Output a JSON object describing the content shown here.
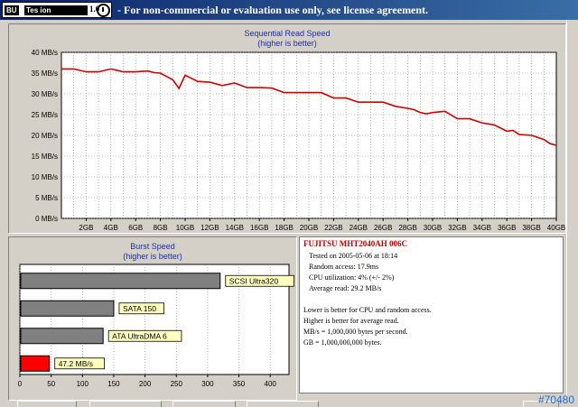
{
  "window": {
    "title_badge": "BU",
    "title_masked": "Tes      ion",
    "title_version": "1.0",
    "title_text": "- For non-commercial or evaluation use only, see license agreement."
  },
  "read_chart": {
    "title_line1": "Sequential Read Speed",
    "title_line2": "(higher is better)"
  },
  "burst_chart": {
    "title_line1": "Burst Speed",
    "title_line2": "(higher is better)"
  },
  "chart_data": [
    {
      "type": "line",
      "title": "Sequential Read Speed (higher is better)",
      "xlabel": "",
      "ylabel": "",
      "y_ticks": [
        "0 MB/s",
        "5 MB/s",
        "10 MB/s",
        "15 MB/s",
        "20 MB/s",
        "25 MB/s",
        "30 MB/s",
        "35 MB/s",
        "40 MB/s"
      ],
      "x_ticks": [
        "2GB",
        "4GB",
        "6GB",
        "8GB",
        "10GB",
        "12GB",
        "14GB",
        "16GB",
        "18GB",
        "20GB",
        "22GB",
        "24GB",
        "26GB",
        "28GB",
        "30GB",
        "32GB",
        "34GB",
        "36GB",
        "38GB",
        "40GB"
      ],
      "ylim": [
        0,
        40
      ],
      "xlim": [
        0,
        40
      ],
      "grid": true,
      "series_color": "#d00000",
      "x": [
        0,
        1,
        2,
        3,
        4,
        5,
        6,
        7,
        7.5,
        8,
        8.5,
        9,
        9.5,
        10,
        11,
        12,
        13,
        14,
        15,
        16,
        17,
        18,
        19,
        20,
        21,
        22,
        23,
        24,
        25,
        26,
        27,
        28,
        28.5,
        29,
        29.5,
        30,
        31,
        32,
        32.5,
        33,
        34,
        35,
        36,
        36.5,
        37,
        38,
        38.5,
        39,
        39.5,
        40
      ],
      "y": [
        36,
        36,
        35.3,
        35.3,
        36,
        35.3,
        35.3,
        35.5,
        35.1,
        35,
        34.2,
        33.4,
        31.3,
        34.5,
        33,
        32.8,
        32,
        32.6,
        31.5,
        31.5,
        31.4,
        30.3,
        30.3,
        30.3,
        30.3,
        29,
        29,
        28,
        28,
        28,
        27,
        26.5,
        26.2,
        25.5,
        25.2,
        25.5,
        25.8,
        24,
        24,
        24,
        23,
        22.5,
        21,
        21.2,
        20.2,
        20,
        19.5,
        19,
        18,
        17.6
      ]
    },
    {
      "type": "bar",
      "title": "Burst Speed (higher is better)",
      "orientation": "horizontal",
      "categories": [
        "SCSI Ultra320",
        "SATA 150",
        "ATA UltraDMA 6",
        "47.2 MB/s"
      ],
      "values": [
        320,
        150,
        133,
        47.2
      ],
      "colors": [
        "#808080",
        "#808080",
        "#808080",
        "#ff0000"
      ],
      "x_ticks": [
        "0",
        "50",
        "100",
        "150",
        "200",
        "250",
        "300",
        "350",
        "400"
      ],
      "xlim": [
        0,
        430
      ],
      "grid": true
    }
  ],
  "info": {
    "drive": "FUJITSU MHT2040AH 006C",
    "tested": "Tested on 2005-05-06 at 18:14",
    "random_access": "Random access: 17.9ms",
    "cpu": "CPU utilization: 4% (+/- 2%)",
    "average": "Average read: 29.2 MB/s",
    "note1": "Lower is better for CPU and random access.",
    "note2": "Higher is better for average read.",
    "note3": "MB/s = 1,000,000 bytes per second.",
    "note4": "GB = 1,000,000,000 bytes."
  },
  "watermark": "#70480"
}
